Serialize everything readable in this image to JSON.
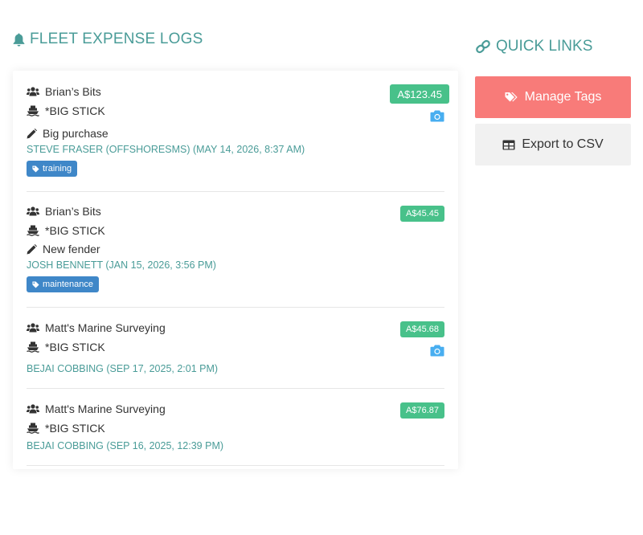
{
  "expense_logs": {
    "title": "FLEET EXPENSE LOGS",
    "entries": [
      {
        "business": "Brian’s Bits",
        "vessel": "*BIG STICK",
        "description": "Big purchase",
        "meta": "STEVE FRASER (OFFSHORESMS) (MAY 14, 2026, 8:37 AM)",
        "tag": "training",
        "amount": "A$123.45",
        "has_photo": true
      },
      {
        "business": "Brian’s Bits",
        "vessel": "*BIG STICK",
        "description": "New fender",
        "meta": "JOSH BENNETT (JAN 15, 2026, 3:56 PM)",
        "tag": "maintenance",
        "amount": "A$45.45",
        "has_photo": false
      },
      {
        "business": "Matt's Marine Surveying",
        "vessel": "*BIG STICK",
        "meta": "BEJAI COBBING (SEP 17, 2025, 2:01 PM)",
        "amount": "A$45.68",
        "has_photo": true
      },
      {
        "business": "Matt's Marine Surveying",
        "vessel": "*BIG STICK",
        "meta": "BEJAI COBBING (SEP 16, 2025, 12:39 PM)",
        "amount": "A$76.87",
        "has_photo": false
      }
    ]
  },
  "quick_links": {
    "title": "QUICK LINKS",
    "manage_tags_label": "Manage Tags",
    "export_csv_label": "Export to CSV"
  },
  "colors": {
    "heading": "#4a9c98",
    "amount_badge": "#48c18a",
    "tag_badge": "#3f87c8",
    "camera": "#48aef0",
    "manage_tags_bg": "#f87b79",
    "export_bg": "#f1f1f1"
  },
  "icons": {
    "title": "bell-icon",
    "business": "users-icon",
    "vessel": "ship-icon",
    "description": "pencil-icon",
    "tag": "tag-icon",
    "photo": "camera-icon",
    "quick_links": "link-icon",
    "manage_tags": "tags-icon",
    "export_csv": "table-icon"
  }
}
